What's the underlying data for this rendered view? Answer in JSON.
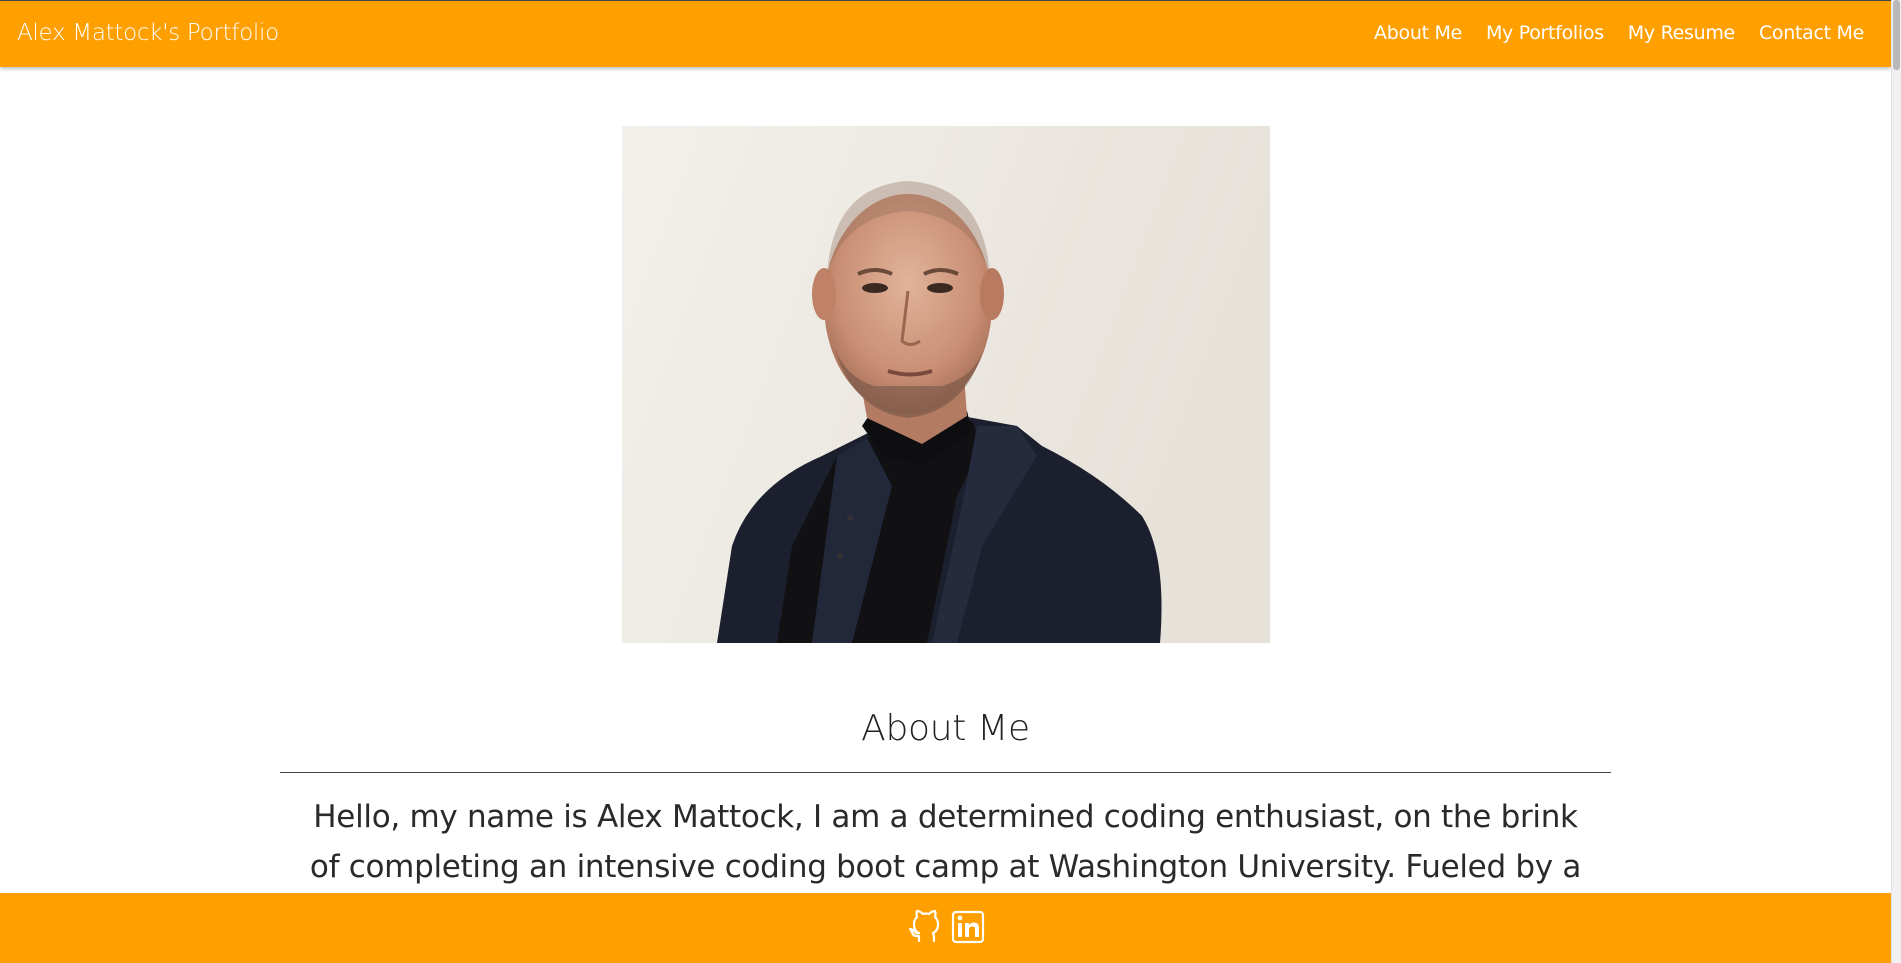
{
  "navbar": {
    "brand": "Alex Mattock's Portfolio",
    "links": [
      {
        "label": "About Me"
      },
      {
        "label": "My Portfolios"
      },
      {
        "label": "My Resume"
      },
      {
        "label": "Contact Me"
      }
    ]
  },
  "profile_photo": {
    "icon": "portrait-photo"
  },
  "about": {
    "title": "About Me",
    "text": "Hello, my name is Alex Mattock, I am a determined coding enthusiast, on the brink of completing an intensive coding boot camp at Washington University. Fueled by a fervent"
  },
  "footer": {
    "icons": [
      "github-icon",
      "linkedin-icon"
    ]
  },
  "colors": {
    "accent": "#ff9f00",
    "text": "#2a2a2a",
    "white": "#ffffff"
  }
}
